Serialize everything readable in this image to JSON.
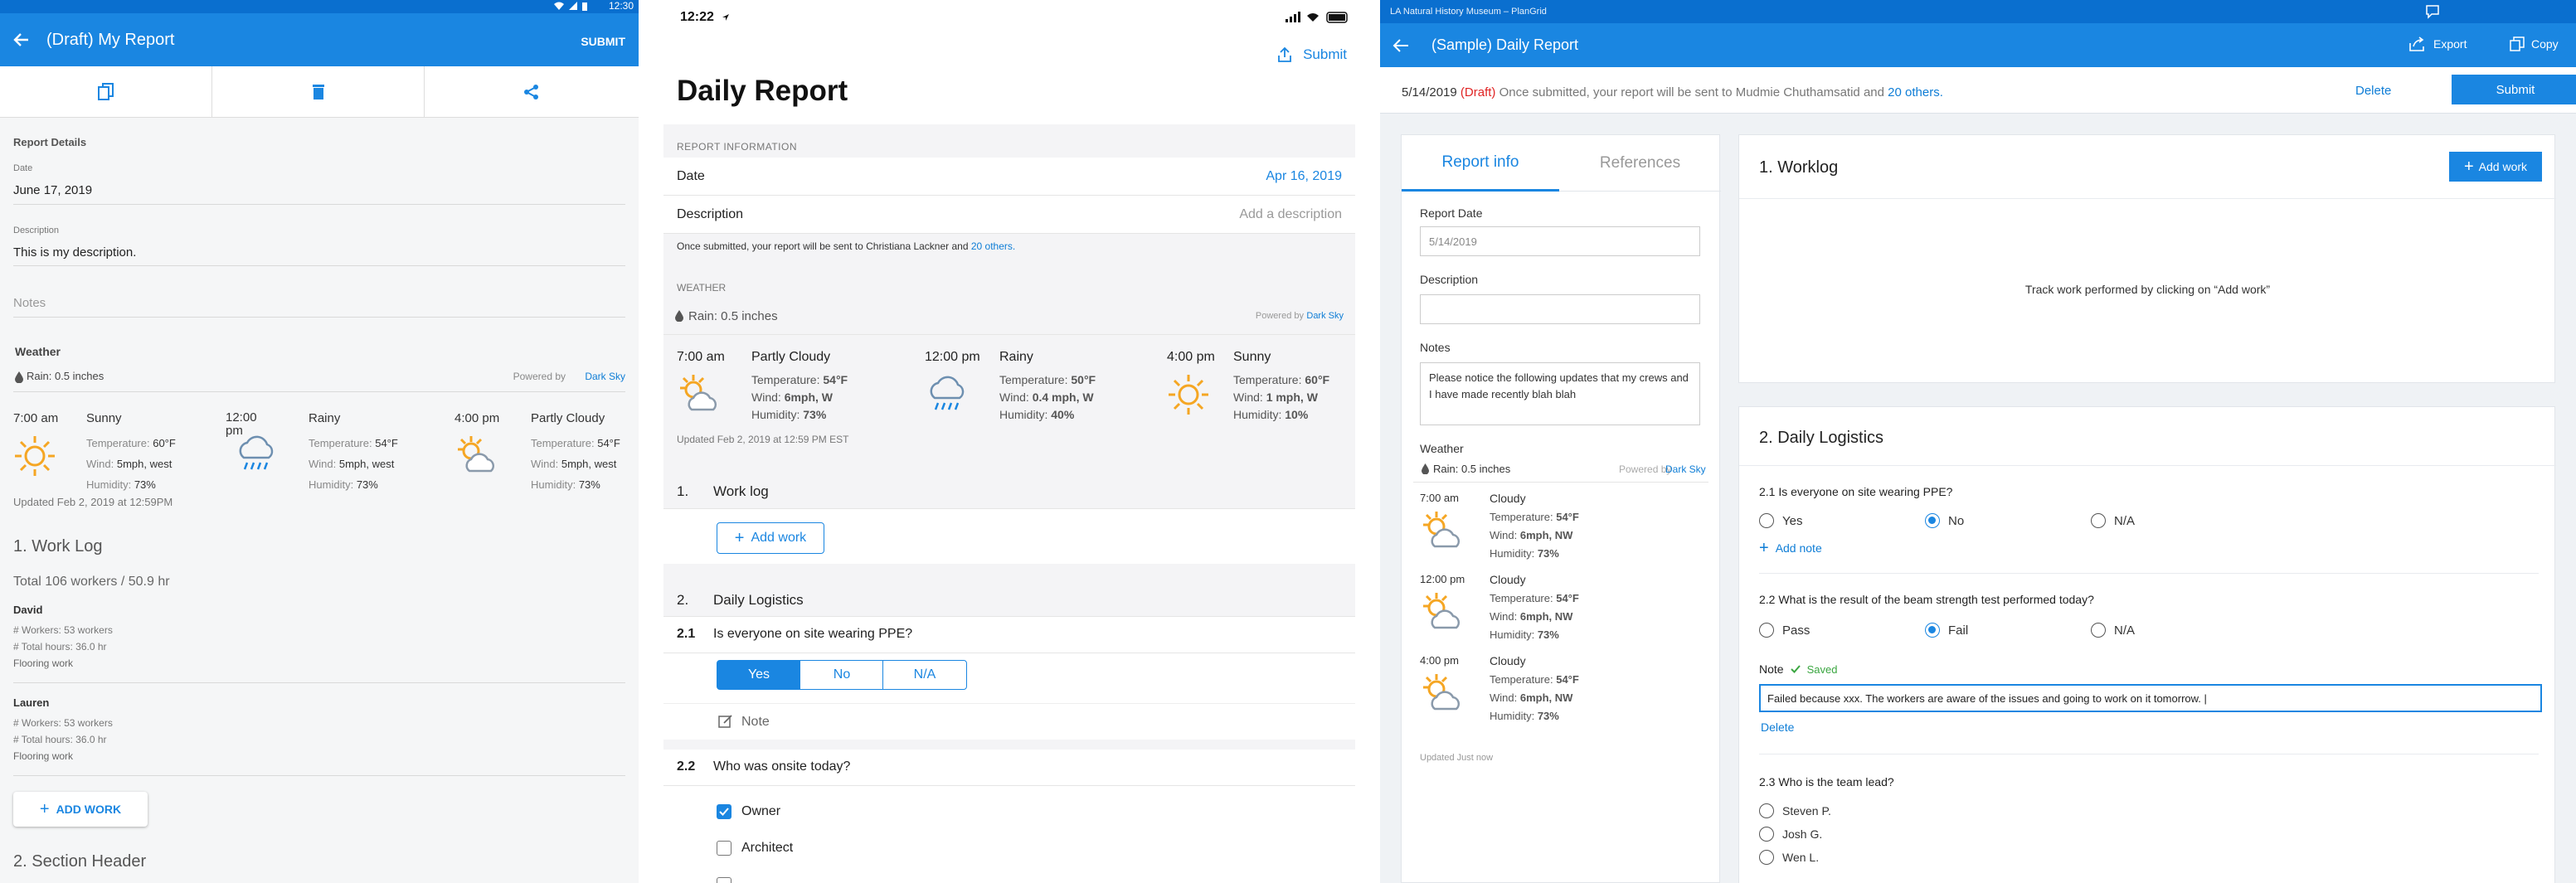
{
  "panel_a": {
    "status_time": "12:30",
    "title": "(Draft) My Report",
    "submit": "SUBMIT",
    "report_details": "Report Details",
    "date_label": "Date",
    "date_value": "June 17, 2019",
    "desc_label": "Description",
    "desc_value": "This is my description.",
    "notes_placeholder": "Notes",
    "weather_title": "Weather",
    "rain": "Rain: 0.5 inches",
    "powered_by": "Powered by",
    "dark_sky": "Dark Sky",
    "weather": [
      {
        "time": "7:00 am",
        "cond": "Sunny",
        "temp_l": "Temperature:",
        "temp": "60°F",
        "wind_l": "Wind:",
        "wind": "5mph, west",
        "hum_l": "Humidity:",
        "hum": "73%",
        "icon": "sun"
      },
      {
        "time": "12:00 pm",
        "cond": "Rainy",
        "temp_l": "Temperature:",
        "temp": "54°F",
        "wind_l": "Wind:",
        "wind": "5mph, west",
        "hum_l": "Humidity:",
        "hum": "73%",
        "icon": "rain"
      },
      {
        "time": "4:00 pm",
        "cond": "Partly Cloudy",
        "temp_l": "Temperature:",
        "temp": "54°F",
        "wind_l": "Wind:",
        "wind": "5mph, west",
        "hum_l": "Humidity:",
        "hum": "73%",
        "icon": "partly"
      }
    ],
    "updated": "Updated Feb 2, 2019 at 12:59PM",
    "worklog_title": "1. Work Log",
    "total": "Total 106 workers / 50.9 hr",
    "workers": [
      {
        "name": "David",
        "count": "# Workers: 53 workers",
        "hours": "# Total hours: 36.0 hr",
        "type": "Flooring work"
      },
      {
        "name": "Lauren",
        "count": "# Workers: 53 workers",
        "hours": "# Total hours: 36.0 hr",
        "type": "Flooring work"
      }
    ],
    "add_work": "ADD WORK",
    "section2": "2. Section Header"
  },
  "panel_b": {
    "status_time": "12:22",
    "submit": "Submit",
    "title": "Daily Report",
    "report_info": "REPORT INFORMATION",
    "date_label": "Date",
    "date_value": "Apr 16, 2019",
    "desc_label": "Description",
    "desc_placeholder": "Add a description",
    "notice_pre": "Once submitted, your report will be sent to Christiana Lackner and",
    "notice_link": "20 others.",
    "weather_title": "WEATHER",
    "rain": "Rain: 0.5 inches",
    "powered_by": "Powered by",
    "dark_sky": "Dark Sky",
    "weather": [
      {
        "time": "7:00 am",
        "cond": "Partly Cloudy",
        "temp": "54°F",
        "wind": "6mph, W",
        "hum": "73%",
        "icon": "partly"
      },
      {
        "time": "12:00 pm",
        "cond": "Rainy",
        "temp": "50°F",
        "wind": "0.4 mph, W",
        "hum": "40%",
        "icon": "rain"
      },
      {
        "time": "4:00 pm",
        "cond": "Sunny",
        "temp": "60°F",
        "wind": "1 mph, W",
        "hum": "10%",
        "icon": "sun"
      }
    ],
    "temp_l": "Temperature:",
    "wind_l": "Wind:",
    "hum_l": "Humidity:",
    "updated": "Updated Feb 2, 2019 at 12:59 PM EST",
    "s1_num": "1.",
    "s1_title": "Work log",
    "add_work": "Add work",
    "s2_num": "2.",
    "s2_title": "Daily Logistics",
    "q21_num": "2.1",
    "q21": "Is everyone on site wearing PPE?",
    "seg": [
      "Yes",
      "No",
      "N/A"
    ],
    "note": "Note",
    "q22_num": "2.2",
    "q22": "Who was onsite today?",
    "checks": [
      {
        "label": "Owner",
        "checked": true
      },
      {
        "label": "Architect",
        "checked": false
      }
    ]
  },
  "panel_c": {
    "window_title": "LA Natural History Museum – PlanGrid",
    "export": "Export",
    "copy": "Copy",
    "title": "(Sample) Daily Report",
    "date": "5/14/2019",
    "draft": "(Draft)",
    "notice_pre": "Once submitted, your report will be sent to Mudmie Chuthamsatid and",
    "notice_link": "20 others.",
    "delete": "Delete",
    "submit": "Submit",
    "tabs": [
      "Report info",
      "References"
    ],
    "report_date_label": "Report Date",
    "report_date_value": "5/14/2019",
    "desc_label": "Description",
    "notes_label": "Notes",
    "notes_value": "Please notice the following updates that my crews and I have made recently blah blah",
    "weather_title": "Weather",
    "rain": "Rain: 0.5 inches",
    "powered_by": "Powered by",
    "dark_sky": "Dark Sky",
    "weather": [
      {
        "time": "7:00 am",
        "cond": "Cloudy",
        "temp": "54°F",
        "wind": "6mph, NW",
        "hum": "73%"
      },
      {
        "time": "12:00 pm",
        "cond": "Cloudy",
        "temp": "54°F",
        "wind": "6mph, NW",
        "hum": "73%"
      },
      {
        "time": "4:00 pm",
        "cond": "Cloudy",
        "temp": "54°F",
        "wind": "6mph, NW",
        "hum": "73%"
      }
    ],
    "temp_l": "Temperature:",
    "wind_l": "Wind:",
    "hum_l": "Humidity:",
    "updated": "Updated Just now",
    "worklog_title": "1. Worklog",
    "add_work": "Add work",
    "worklog_empty": "Track work performed by clicking on “Add work”",
    "logistics_title": "2. Daily Logistics",
    "q21": "2.1 Is everyone on site wearing PPE?",
    "q21_opts": [
      "Yes",
      "No",
      "N/A"
    ],
    "add_note": "Add note",
    "q22": "2.2 What is the result of the beam strength test performed today?",
    "q22_opts": [
      "Pass",
      "Fail",
      "N/A"
    ],
    "note_label": "Note",
    "saved": "Saved",
    "note_value": "Failed because xxx. The workers are aware of the issues and going to work on it tomorrow. |",
    "note_delete": "Delete",
    "q23": "2.3 Who is the team lead?",
    "q23_opts": [
      "Steven P.",
      "Josh G.",
      "Wen L."
    ],
    "colors": {
      "primary": "#1a86e1",
      "draft": "#e02424",
      "saved": "#3aa640"
    }
  }
}
